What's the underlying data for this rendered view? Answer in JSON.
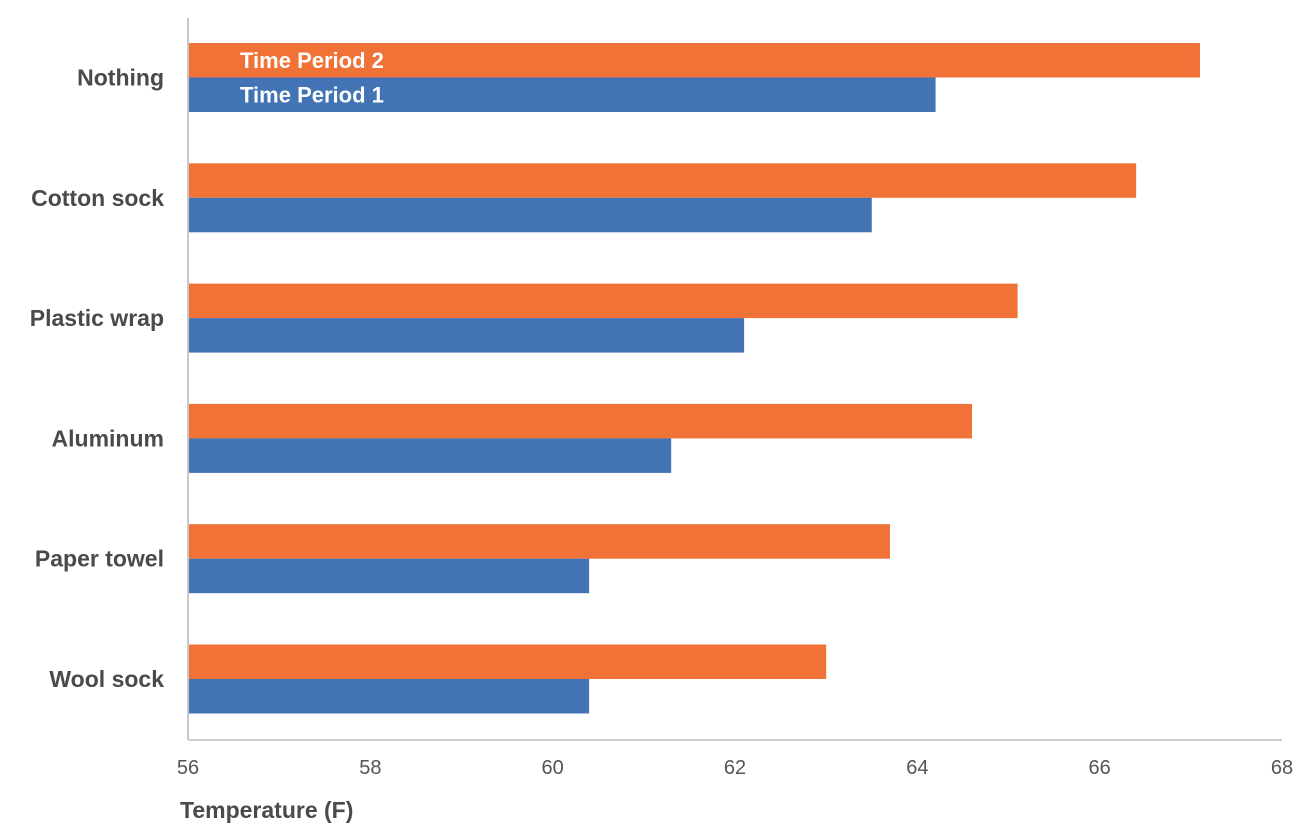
{
  "chart_data": {
    "type": "bar",
    "orientation": "horizontal",
    "title": "",
    "xlabel": "Temperature (F)",
    "ylabel": "",
    "xlim": [
      56,
      68
    ],
    "xticks": [
      56,
      58,
      60,
      62,
      64,
      66,
      68
    ],
    "xtick_labels": [
      "56",
      "58",
      "60",
      "62",
      "64",
      "66",
      "68"
    ],
    "grid": false,
    "categories": [
      "Nothing",
      "Cotton sock",
      "Plastic wrap",
      "Aluminum",
      "Paper towel",
      "Wool sock"
    ],
    "series": [
      {
        "name": "Time Period 2",
        "color": "#F07236",
        "values": [
          67.1,
          66.4,
          65.1,
          64.6,
          63.7,
          63.0
        ]
      },
      {
        "name": "Time Period 1",
        "color": "#4274B5",
        "values": [
          64.2,
          63.5,
          62.1,
          61.3,
          60.4,
          60.4
        ]
      }
    ],
    "legend": {
      "placement": "inside-top-left",
      "entries": [
        "Time Period 2",
        "Time Period 1"
      ]
    },
    "axis_color": "#c8c8c8"
  }
}
